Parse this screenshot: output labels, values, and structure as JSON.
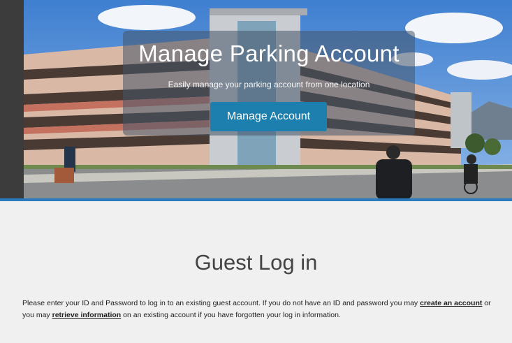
{
  "hero": {
    "title": "Manage Parking Account",
    "subtitle": "Easily manage your parking account from one location",
    "button_label": "Manage Account",
    "accent_color": "#1d7fad"
  },
  "guest": {
    "title": "Guest Log in",
    "intro_part1": "Please enter your ID and Password to log in to an existing guest account. If you do not have an ID and password you may ",
    "link_create": "create an account",
    "intro_part2": " or you may ",
    "link_retrieve": "retrieve information",
    "intro_part3": " on an existing account if you have forgotten your log in information."
  }
}
